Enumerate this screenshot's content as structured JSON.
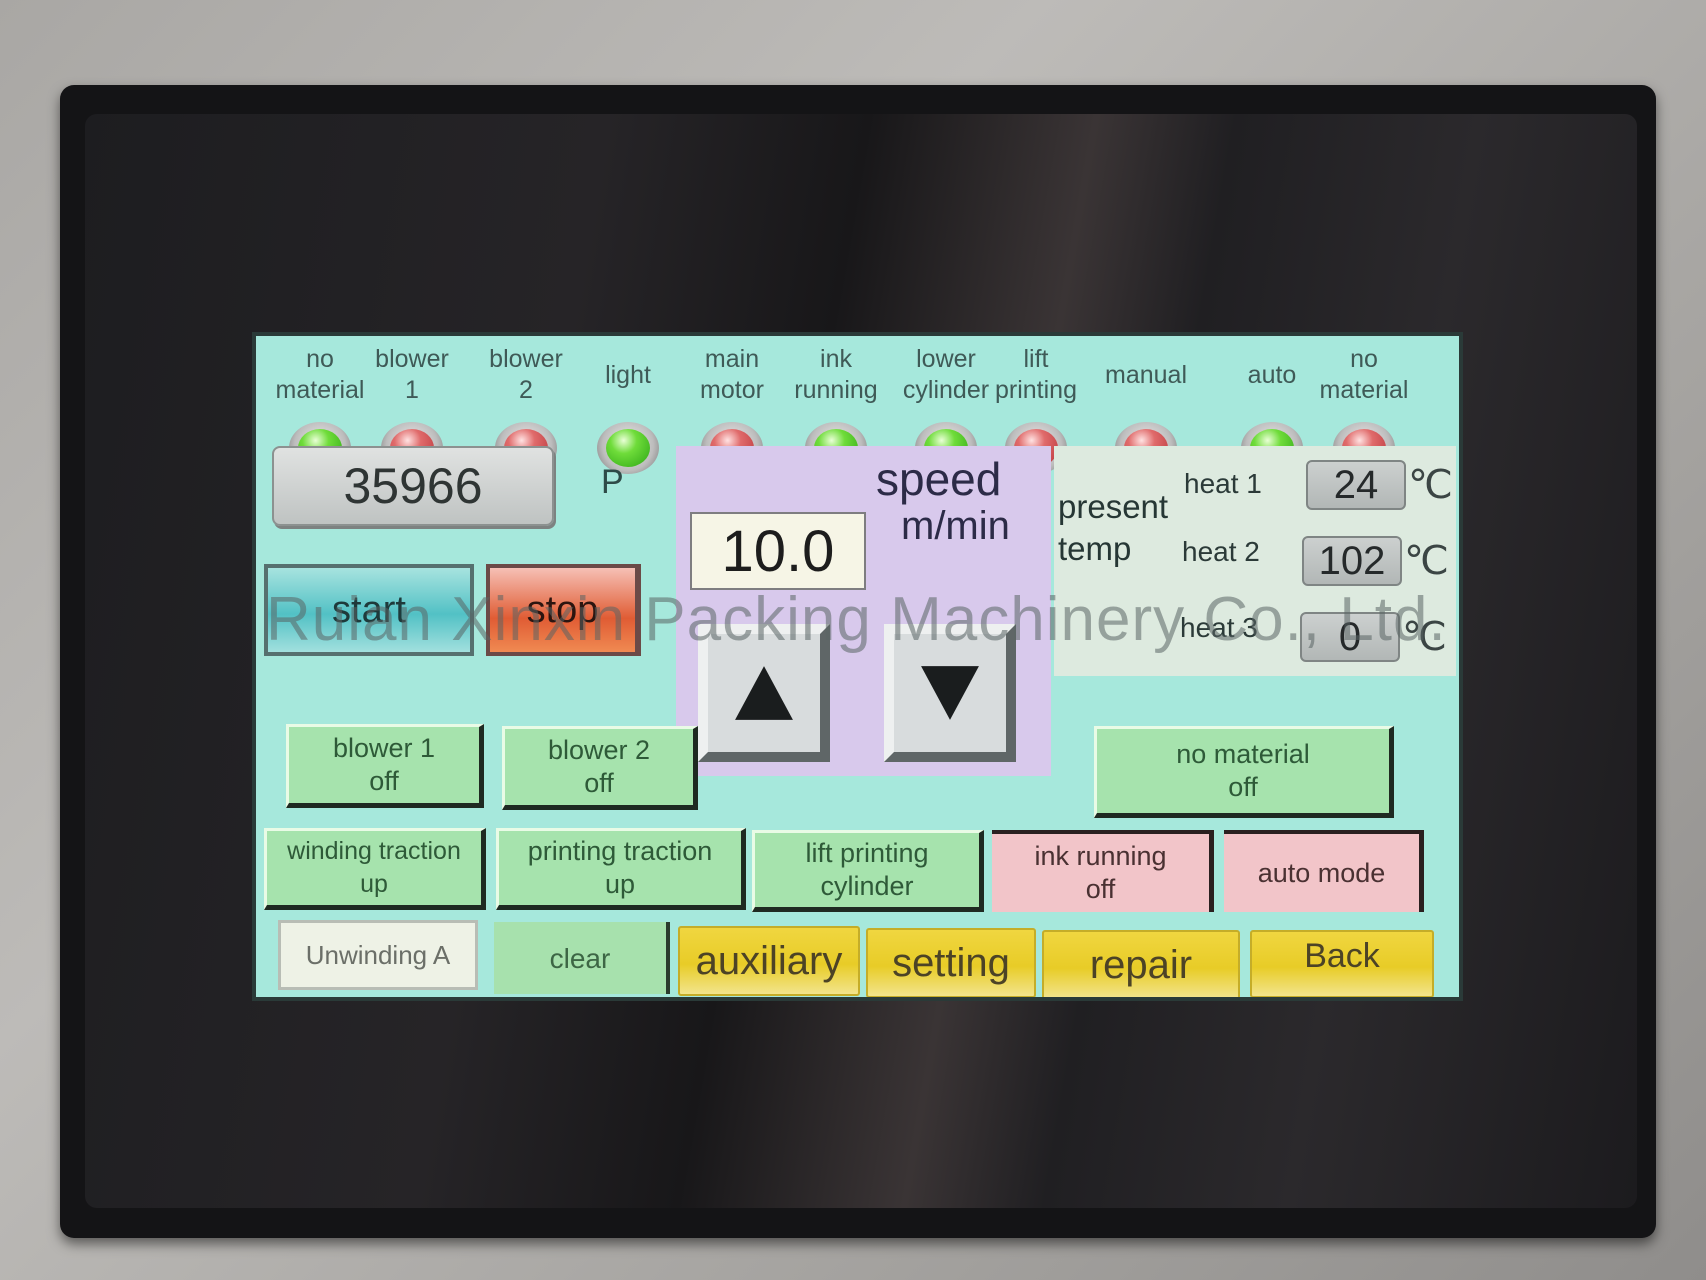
{
  "indicators": [
    {
      "label": "no\nmaterial",
      "state": "green"
    },
    {
      "label": "blower\n1",
      "state": "red"
    },
    {
      "label": "blower\n2",
      "state": "red"
    },
    {
      "label": "light",
      "state": "green"
    },
    {
      "label": "main\nmotor",
      "state": "red"
    },
    {
      "label": "ink\nrunning",
      "state": "green"
    },
    {
      "label": "lower\ncylinder",
      "state": "green"
    },
    {
      "label": "lift\nprinting",
      "state": "red"
    },
    {
      "label": "manual",
      "state": "red"
    },
    {
      "label": "auto",
      "state": "green"
    },
    {
      "label": "no\nmaterial",
      "state": "red"
    }
  ],
  "counter": {
    "value": "35966",
    "unit": "P"
  },
  "controls": {
    "start": "start",
    "stop": "stop"
  },
  "speed": {
    "title": "speed",
    "unit": "m/min",
    "value": "10.0"
  },
  "temperature": {
    "title_line1": "present",
    "title_line2": "temp",
    "unit": "℃",
    "zones": [
      {
        "label": "heat 1",
        "value": "24"
      },
      {
        "label": "heat 2",
        "value": "102"
      },
      {
        "label": "heat 3",
        "value": "0"
      }
    ]
  },
  "buttons": {
    "blower1": "blower 1\noff",
    "blower2": "blower 2\noff",
    "no_material": "no material\noff",
    "winding_traction": "winding traction\nup",
    "printing_traction": "printing traction\nup",
    "lift_printing": "lift printing\ncylinder",
    "ink_running": "ink running\noff",
    "auto_mode": "auto mode",
    "unwinding": "Unwinding A",
    "clear": "clear",
    "auxiliary": "auxiliary",
    "setting": "setting",
    "repair": "repair",
    "back": "Back"
  },
  "watermark": "Ruian Xinxin Packing Machinery Co., Ltd."
}
